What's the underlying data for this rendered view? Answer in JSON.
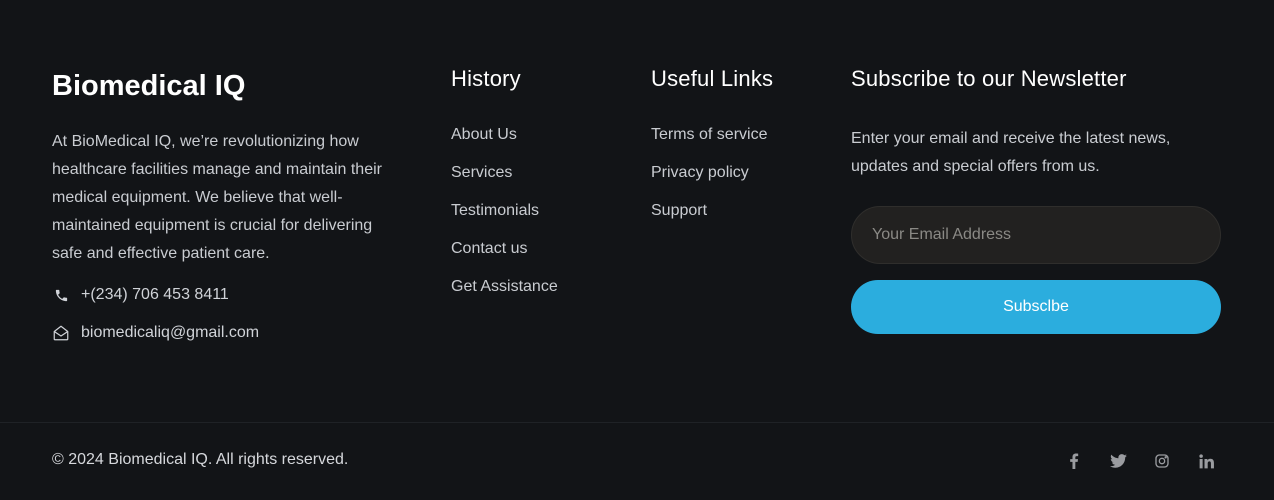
{
  "brand": {
    "title": "Biomedical IQ",
    "description": "At BioMedical IQ, we’re revolutionizing how healthcare facilities manage and maintain their medical equipment. We believe that well-maintained equipment is crucial for delivering safe and effective patient care.",
    "phone": "+(234) 706 453 8411",
    "email": "biomedicaliq@gmail.com",
    "phone_icon": "phone-icon",
    "email_icon": "envelope-open-icon"
  },
  "history": {
    "heading": "History",
    "links": [
      "About Us",
      "Services",
      "Testimonials",
      "Contact us",
      "Get Assistance"
    ]
  },
  "useful_links": {
    "heading": "Useful Links",
    "links": [
      "Terms of service",
      "Privacy policy",
      "Support"
    ]
  },
  "newsletter": {
    "heading": "Subscribe to our Newsletter",
    "description": "Enter your email and receive the latest news, updates and special offers from us.",
    "email_placeholder": "Your Email Address",
    "email_value": "",
    "button_label": "Subsclbe"
  },
  "bottom": {
    "copyright": "© 2024 Biomedical IQ. All rights reserved.",
    "socials": [
      "facebook-icon",
      "twitter-icon",
      "instagram-icon",
      "linkedin-icon"
    ]
  },
  "colors": {
    "background": "#121417",
    "accent": "#2badde",
    "input_background": "#222120",
    "text": "#c9ccd1"
  }
}
